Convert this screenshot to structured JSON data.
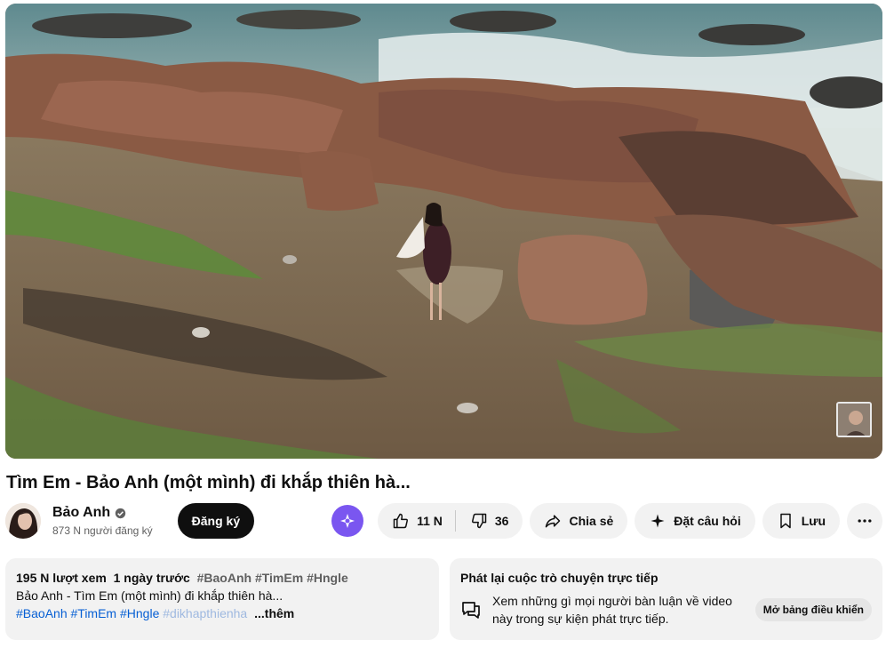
{
  "video": {
    "title": "Tìm Em - Bảo Anh (một mình) đi khắp thiên hà..."
  },
  "channel": {
    "name": "Bảo Anh",
    "subscribers": "873 N người đăng ký",
    "subscribe_label": "Đăng ký"
  },
  "actions": {
    "likes": "11 N",
    "dislikes": "36",
    "share_label": "Chia sẻ",
    "ask_label": "Đặt câu hỏi",
    "save_label": "Lưu"
  },
  "description": {
    "views": "195 N lượt xem",
    "uploaded": "1 ngày trước",
    "header_tags": [
      "#BaoAnh",
      "#TimEm",
      "#Hngle"
    ],
    "line": "Bảo Anh - Tìm Em (một mình) đi khắp thiên hà...",
    "tags": [
      "#BaoAnh",
      "#TimEm",
      "#Hngle"
    ],
    "faded_tag": "#dikhapthienha",
    "more_label": "...thêm"
  },
  "live_chat": {
    "heading": "Phát lại cuộc trò chuyện trực tiếp",
    "body": "Xem những gì mọi người bàn luận về video này trong sự kiện phát trực tiếp.",
    "button_label": "Mở bảng điều khiển"
  },
  "colors": {
    "subscribe_bg": "#0f0f0f",
    "pill_bg": "#f2f2f2",
    "ai_bg": "#7a56f0",
    "hashtag": "#065fd4"
  }
}
